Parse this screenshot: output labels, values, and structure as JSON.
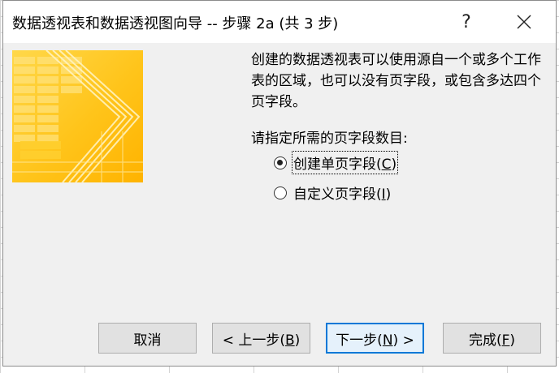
{
  "dialog": {
    "title": "数据透视表和数据透视图向导 -- 步骤 2a (共 3 步)",
    "help_label": "?",
    "description": "创建的数据透视表可以使用源自一个或多个工作表的区域，也可以没有页字段，或包含多达四个页字段。",
    "prompt": "请指定所需的页字段数目:",
    "options": [
      {
        "label_pre": "创建单页字段(",
        "accel": "C",
        "label_post": ")",
        "selected": true
      },
      {
        "label_pre": "自定义页字段(",
        "accel": "I",
        "label_post": ")",
        "selected": false
      }
    ],
    "buttons": {
      "cancel": {
        "label": "取消"
      },
      "back": {
        "pre": "< 上一步(",
        "accel": "B",
        "post": ")"
      },
      "next": {
        "pre": "下一步(",
        "accel": "N",
        "post": ") >"
      },
      "finish": {
        "pre": "完成(",
        "accel": "F",
        "post": ")"
      }
    }
  },
  "icons": {
    "close": "close-icon",
    "help": "help-icon",
    "wizard_image": "pivot-wizard-illustration"
  },
  "colors": {
    "dialog_bg": "#f0f0f0",
    "titlebar_bg": "#ffffff",
    "accent": "#0078d7",
    "illustration_yellow": "#ffc61a"
  }
}
